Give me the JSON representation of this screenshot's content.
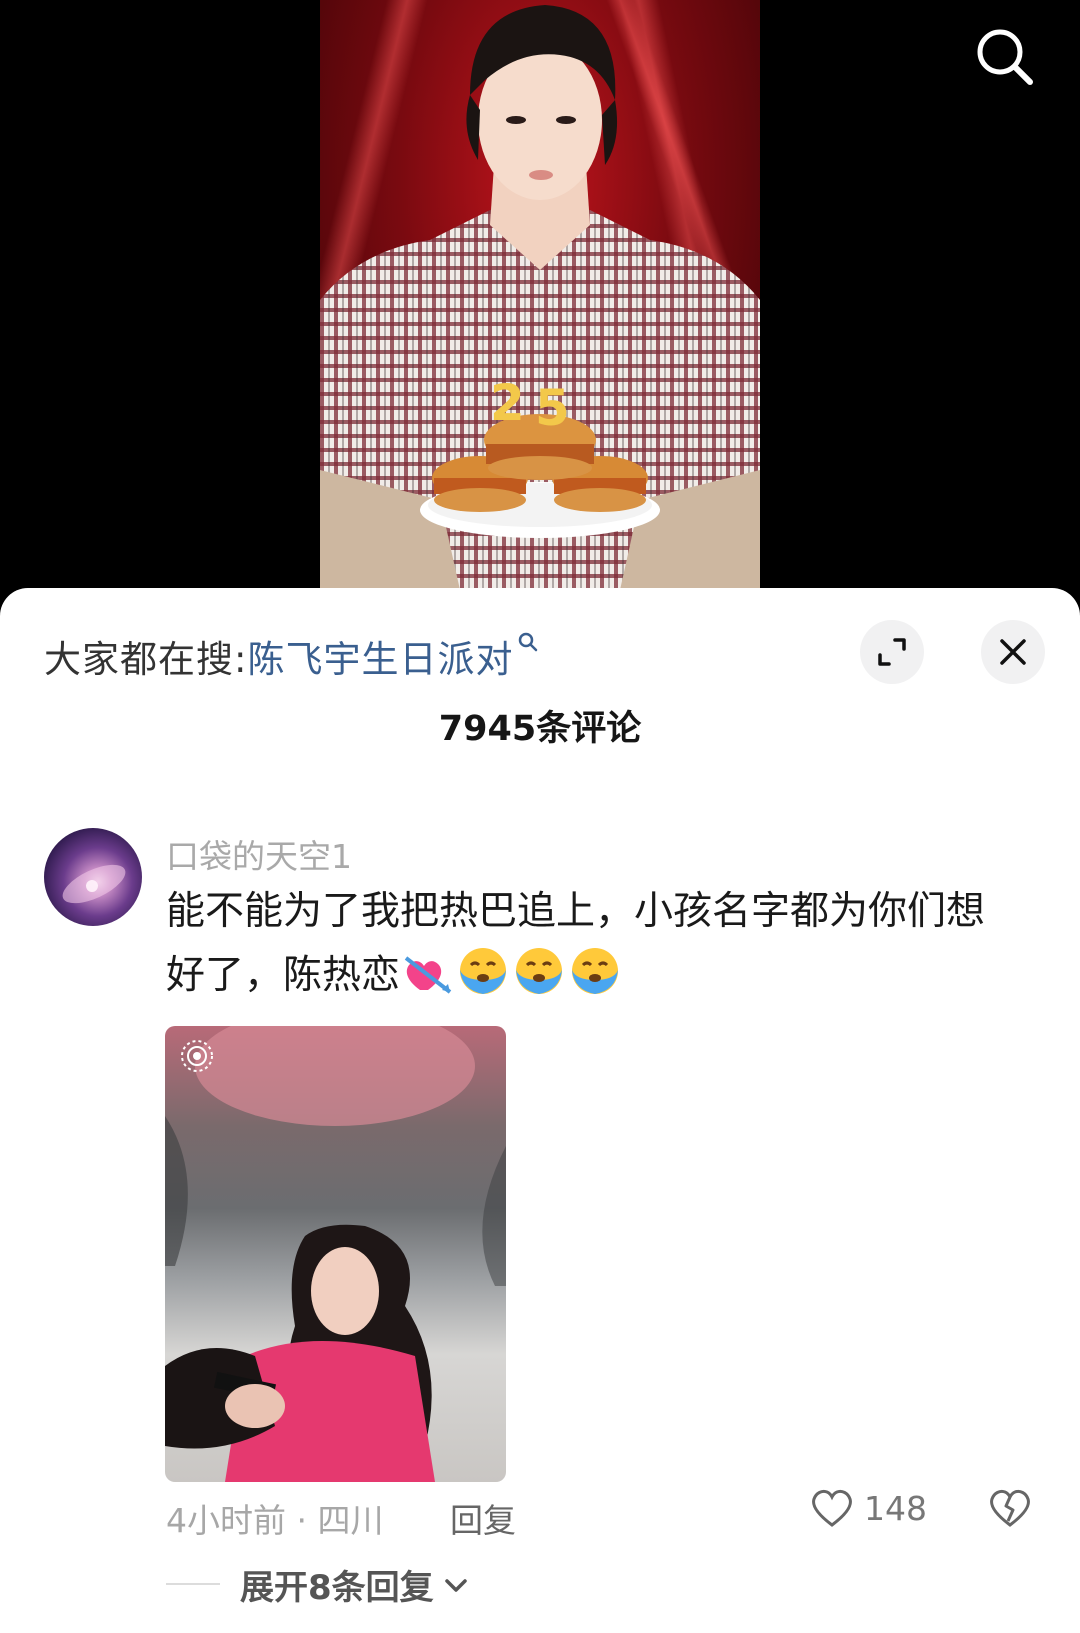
{
  "search": {
    "icon": "search-icon"
  },
  "sheet": {
    "hot_prefix": "大家都在搜:",
    "hot_link": "陈飞宇生日派对",
    "expand_icon": "expand-icon",
    "close_icon": "close-icon",
    "count_title": "7945条评论"
  },
  "comment": {
    "username": "口袋的天空1",
    "text": "能不能为了我把热巴追上，小孩名字都为你们想好了，陈热恋",
    "emojis": [
      "heart-arrow-emoji",
      "crying-face-emoji",
      "crying-face-emoji",
      "crying-face-emoji"
    ],
    "time_location": "4小时前 · 四川",
    "reply_label": "回复",
    "like_count": "148",
    "expand_replies": "展开8条回复"
  },
  "colors": {
    "link": "#3a5f8f",
    "muted": "#a9a9a9"
  }
}
